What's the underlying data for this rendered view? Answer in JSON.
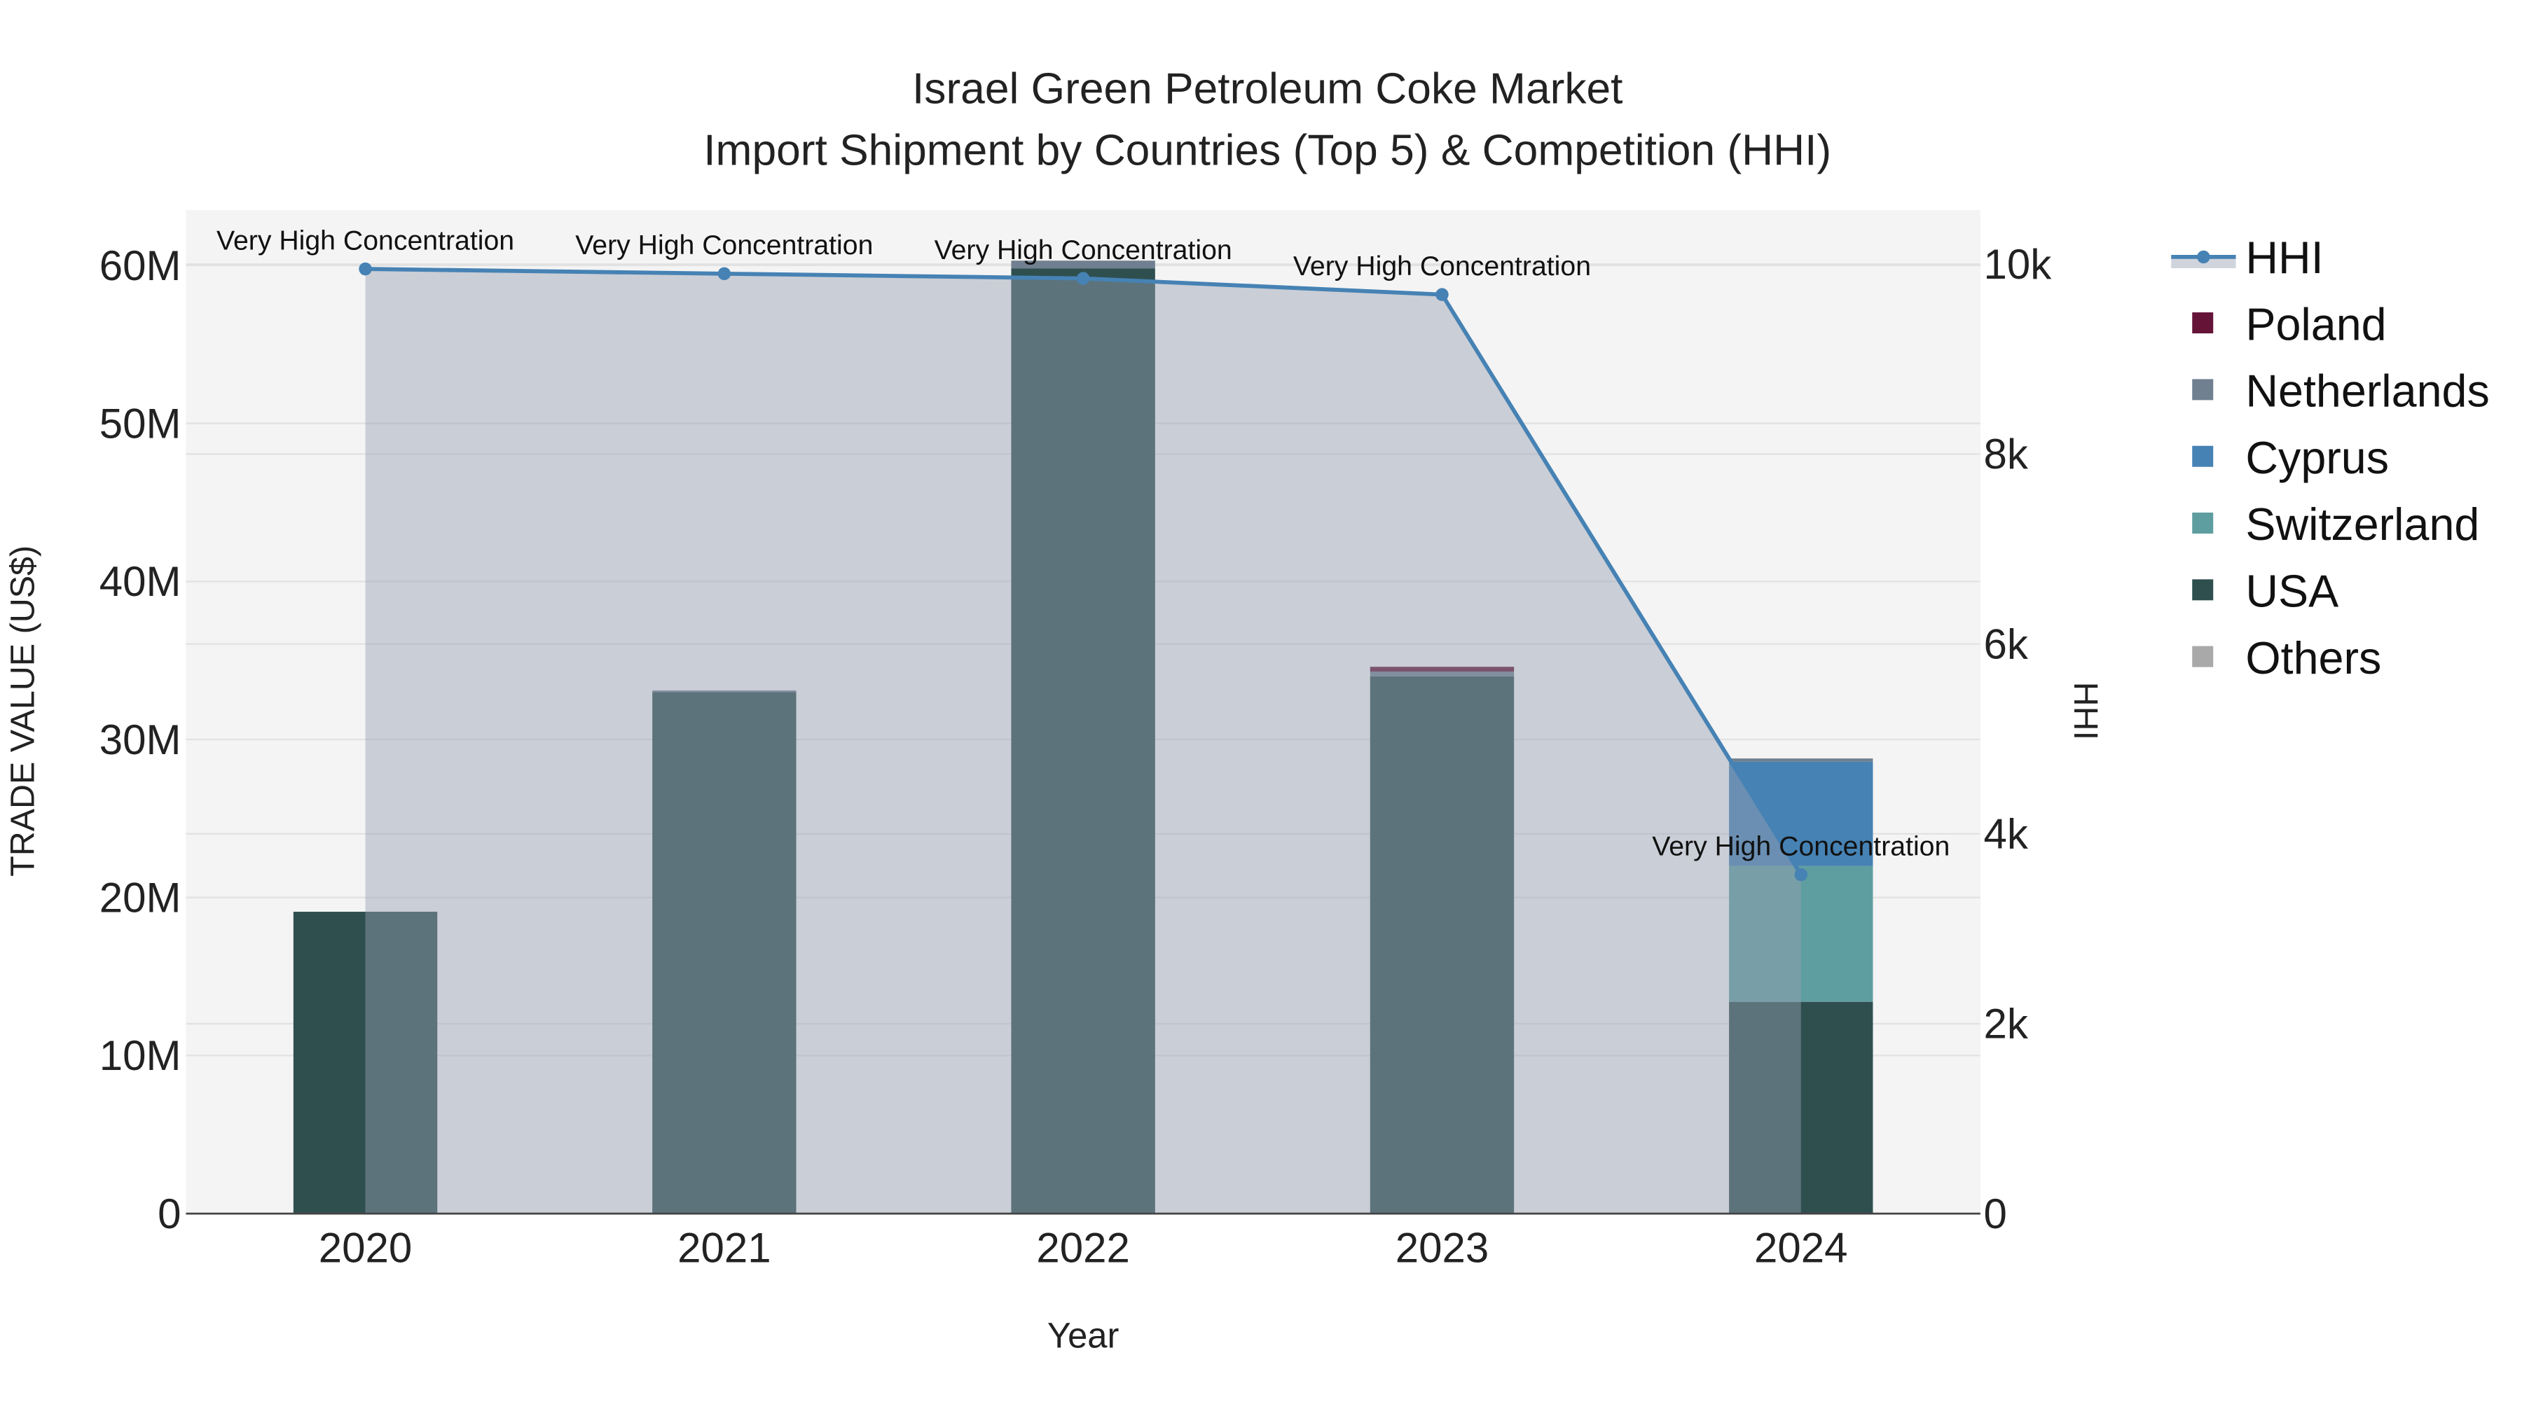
{
  "chart_data": {
    "type": "bar",
    "title_line1": "Israel Green Petroleum Coke Market",
    "title_line2": "Import Shipment by Countries (Top 5) & Competition (HHI)",
    "xlabel": "Year",
    "ylabel": "TRADE VALUE (US$)",
    "y2label": "HHI",
    "categories": [
      "2020",
      "2021",
      "2022",
      "2023",
      "2024"
    ],
    "ylim": [
      0,
      63.5
    ],
    "y_unit": "M",
    "y_ticks": [
      0,
      10,
      20,
      30,
      40,
      50,
      60
    ],
    "y_tick_labels": [
      "0",
      "10M",
      "20M",
      "30M",
      "40M",
      "50M",
      "60M"
    ],
    "y2lim": [
      0,
      10570
    ],
    "y2_ticks": [
      0,
      2000,
      4000,
      6000,
      8000,
      10000
    ],
    "y2_tick_labels": [
      "0",
      "2k",
      "4k",
      "6k",
      "8k",
      "10k"
    ],
    "grid": true,
    "legend_position": "right",
    "series": [
      {
        "name": "USA",
        "color": "#2f4f4f",
        "values": [
          19.1,
          33.0,
          59.8,
          34.0,
          13.4
        ]
      },
      {
        "name": "Switzerland",
        "color": "#5f9ea0",
        "values": [
          0,
          0,
          0,
          0,
          8.6
        ]
      },
      {
        "name": "Cyprus",
        "color": "#4682b4",
        "values": [
          0,
          0,
          0,
          0,
          6.6
        ]
      },
      {
        "name": "Netherlands",
        "color": "#708090",
        "values": [
          0,
          0.1,
          0.5,
          0.3,
          0.2
        ]
      },
      {
        "name": "Poland",
        "color": "#651438",
        "values": [
          0,
          0,
          0,
          0.3,
          0
        ]
      },
      {
        "name": "Others",
        "color": "#a9a9a9",
        "values": [
          0,
          0,
          0,
          0,
          0
        ]
      }
    ],
    "hhi": {
      "name": "HHI",
      "color": "#4682b4",
      "fill": "rgba(150,160,178,0.45)",
      "values": [
        9950,
        9900,
        9850,
        9680,
        3570
      ],
      "annotations": [
        "Very High Concentration",
        "Very High Concentration",
        "Very High Concentration",
        "Very High Concentration",
        "Very High Concentration"
      ]
    },
    "legend_order": [
      "HHI",
      "Poland",
      "Netherlands",
      "Cyprus",
      "Switzerland",
      "USA",
      "Others"
    ]
  }
}
